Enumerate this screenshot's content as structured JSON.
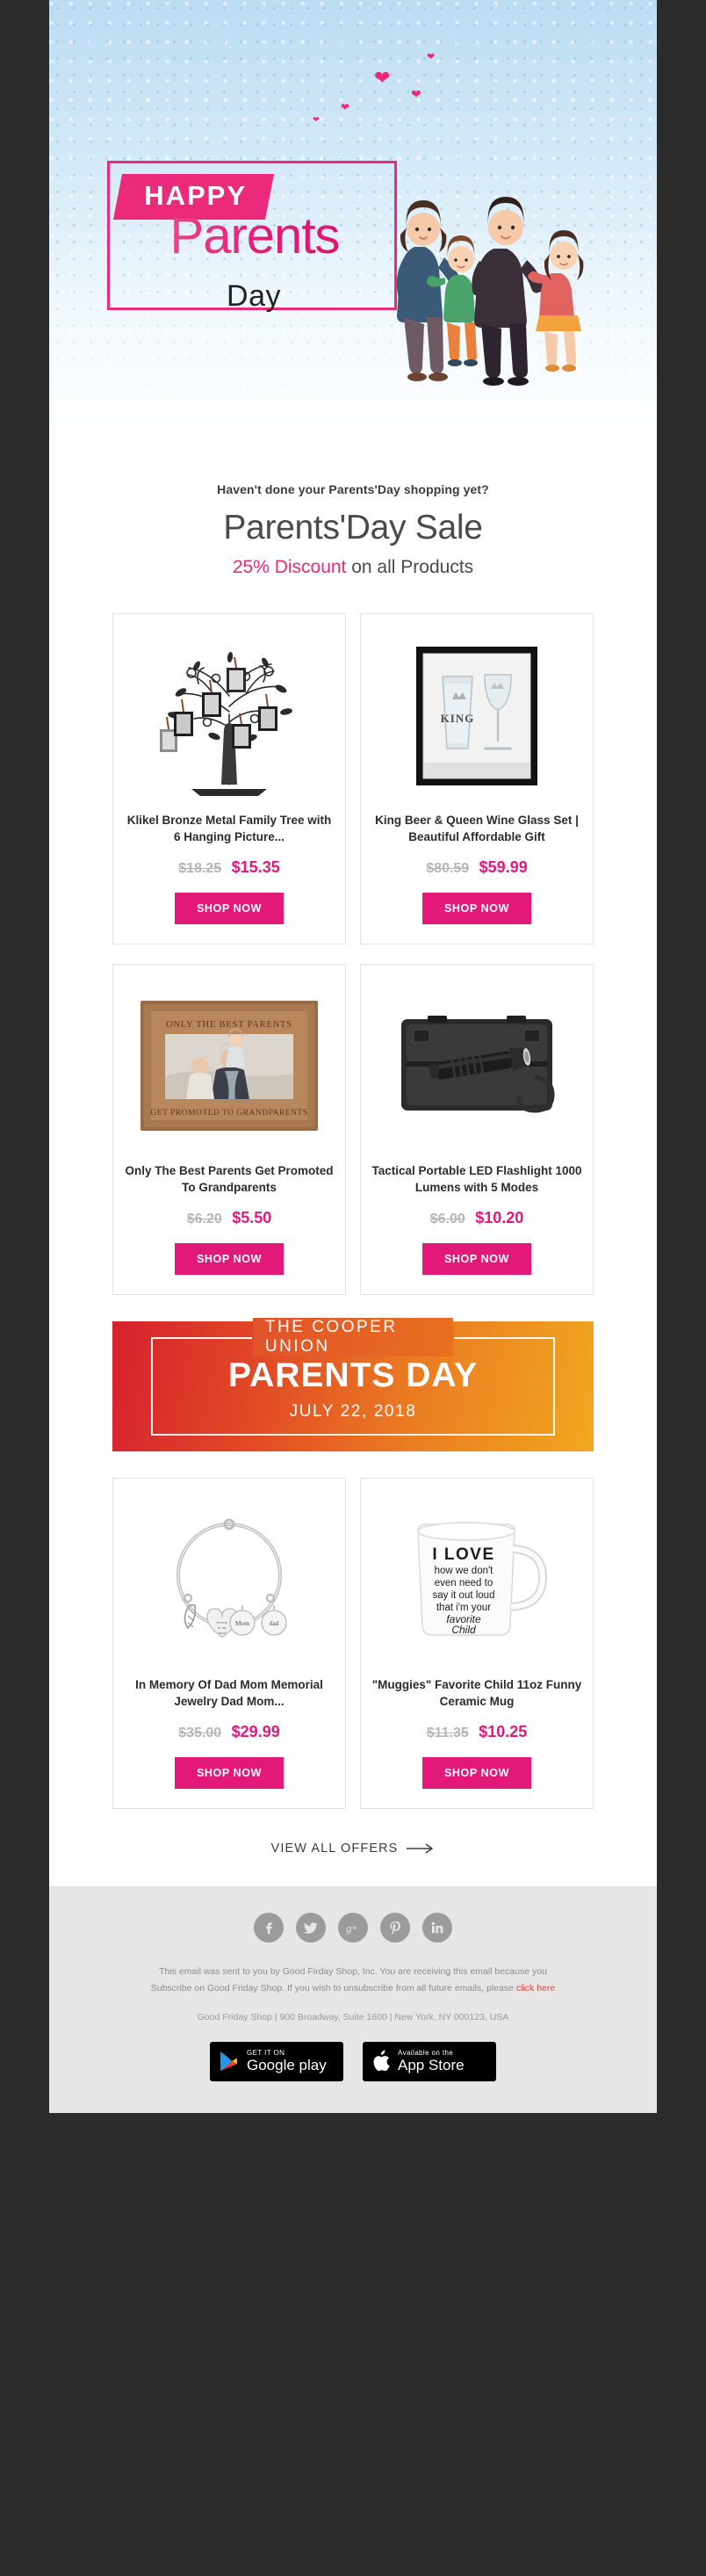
{
  "hero": {
    "happy_label": "HAPPY",
    "parents_label": "Parents",
    "day_label": "Day",
    "illustration_name": "family-illustration"
  },
  "sale": {
    "kicker": "Haven't done your Parents'Day shopping yet?",
    "title": "Parents'Day Sale",
    "discount": "25% Discount",
    "sub_rest": " on all Products"
  },
  "products": [
    {
      "title": "Klikel Bronze Metal Family Tree with 6 Hanging Picture...",
      "old_price": "$18.25",
      "new_price": "$15.35",
      "cta": "SHOP NOW",
      "image": "family-tree-photo-frame"
    },
    {
      "title": "King Beer & Queen Wine Glass Set | Beautiful Affordable Gift",
      "old_price": "$80.59",
      "new_price": "$59.99",
      "cta": "SHOP NOW",
      "image": "king-queen-glass-set"
    },
    {
      "title": "Only The Best Parents Get Promoted To Grandparents",
      "old_price": "$6.20",
      "new_price": "$5.50",
      "cta": "SHOP NOW",
      "image": "wooden-picture-frame",
      "frame_top_text": "ONLY THE BEST PARENTS",
      "frame_bottom_text": "GET PROMOTED TO GRANDPARENTS"
    },
    {
      "title": "Tactical Portable LED Flashlight 1000 Lumens with 5 Modes",
      "old_price": "$6.00",
      "new_price": "$10.20",
      "cta": "SHOP NOW",
      "image": "led-flashlight-case"
    },
    {
      "title": "In Memory Of Dad Mom Memorial Jewelry Dad Mom...",
      "old_price": "$35.00",
      "new_price": "$29.99",
      "cta": "SHOP NOW",
      "image": "memorial-charm-bracelet",
      "charm_labels": [
        "Forever in my heart",
        "Mom",
        "dad"
      ]
    },
    {
      "title": "\"Muggies\" Favorite Child 11oz Funny Ceramic Mug",
      "old_price": "$11.35",
      "new_price": "$10.25",
      "cta": "SHOP NOW",
      "image": "ceramic-mug",
      "mug_lines": [
        "I LOVE",
        "how we don't",
        "even need to",
        "say it out loud",
        "that i'm your",
        "favorite",
        "Child"
      ]
    }
  ],
  "banner": {
    "kicker": "THE COOPER UNION",
    "title": "PARENTS DAY",
    "date": "JULY 22, 2018"
  },
  "view_all": {
    "label": "VIEW ALL OFFERS",
    "arrow": "arrow-right-icon"
  },
  "footer": {
    "social": [
      {
        "name": "facebook-icon",
        "glyph": "f"
      },
      {
        "name": "twitter-icon",
        "glyph": "t"
      },
      {
        "name": "google-plus-icon",
        "glyph": "g+"
      },
      {
        "name": "pinterest-icon",
        "glyph": "P"
      },
      {
        "name": "linkedin-icon",
        "glyph": "in"
      }
    ],
    "legal_line1": "This email was sent to you by Good Firday Shop, Inc. You are receiving this email because you",
    "legal_line2_pre": "Subscribe on Good Friday Shop. If you wish to unsubscribe from all future emails, please ",
    "legal_link": "click here",
    "address": "Good Friday Shop | 900 Broadway, Suite 1600 | New York, NY 000123, USA",
    "google_play": {
      "small": "GET IT ON",
      "big": "Google play"
    },
    "app_store": {
      "small": "Available on the",
      "big": "App Store"
    }
  },
  "colors": {
    "brand_pink": "#e3197a",
    "hero_pink": "#ec2a7b",
    "banner_red": "#d6212f",
    "banner_orange": "#f0a81f",
    "link_red": "#e8403f"
  }
}
